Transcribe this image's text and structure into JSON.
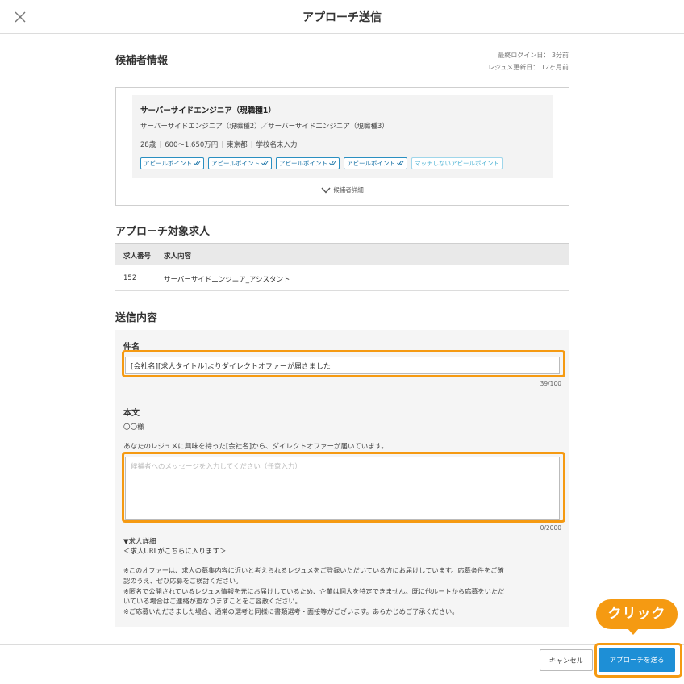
{
  "header": {
    "title": "アプローチ送信",
    "close_icon": "close-icon"
  },
  "candidate": {
    "section_title": "候補者情報",
    "last_login": "最終ログイン日： 3分前",
    "resume_updated": "レジュメ更新日： 12ヶ月前",
    "job_title": "サーバーサイドエンジニア（現職種1）",
    "job_sub": "サーバーサイドエンジニア（現職種2）／サーバーサイドエンジニア（現職種3）",
    "info": [
      "28歳",
      "600〜1,650万円",
      "東京都",
      "学校名未入力"
    ],
    "tags": [
      {
        "label": "アピールポイント",
        "matched": true
      },
      {
        "label": "アピールポイント",
        "matched": true
      },
      {
        "label": "アピールポイント",
        "matched": true
      },
      {
        "label": "アピールポイント",
        "matched": true
      },
      {
        "label": "マッチしないアピールポイント",
        "matched": false
      }
    ],
    "details_label": "候補者詳細"
  },
  "target_jobs": {
    "section_title": "アプローチ対象求人",
    "columns": [
      "求人番号",
      "求人内容"
    ],
    "rows": [
      {
        "id": "152",
        "content": "サーバーサイドエンジニア_アシスタント"
      }
    ]
  },
  "send_content": {
    "section_title": "送信内容",
    "subject_label": "件名",
    "subject_value": "[会社名][求人タイトル]よりダイレクトオファーが届きました",
    "subject_counter": "39/100",
    "body_label": "本文",
    "salutation": "〇〇様",
    "intro_line": "あなたのレジュメに興味を持った[会社名]から、ダイレクトオファーが届いています。",
    "message_placeholder": "候補者へのメッセージを入力してください（任意入力）",
    "message_counter": "0/2000",
    "job_detail_heading": "▼求人詳細",
    "job_url_line": "＜求人URLがこちらに入ります＞",
    "notes": [
      "※このオファーは、求人の募集内容に近いと考えられるレジュメをご登録いただいている方にお届けしています。応募条件をご確",
      "認のうえ、ぜひ応募をご検討ください。",
      "※匿名で公開されているレジュメ情報を元にお届けしているため、企業は個人を特定できません。既に他ルートから応募をいただ",
      "いている場合はご連絡が重なりますことをご容赦ください。",
      "※ご応募いただきました場合、通常の選考と同様に書類選考・面接等がございます。あらかじめご了承ください。"
    ]
  },
  "footer": {
    "cancel_label": "キャンセル",
    "send_label": "アプローチを送る"
  },
  "annotation": {
    "callout_label": "クリック",
    "highlight_color": "#f59a12"
  },
  "colors": {
    "accent": "#1e8fd6",
    "tag_border": "#2a8fc1"
  }
}
